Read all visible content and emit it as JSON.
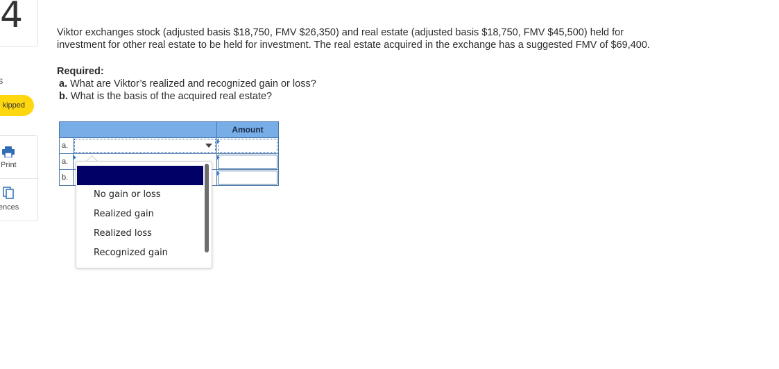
{
  "sidebar": {
    "question_number": "4",
    "points_label": "S",
    "status_badge": "kipped",
    "print_label": "Print",
    "references_label": "ferences"
  },
  "question": {
    "line1": "Viktor exchanges stock (adjusted basis $18,750, FMV $26,350) and real estate (adjusted basis $18,750, FMV $45,500) held for",
    "line2": "investment for other real estate to be held for investment. The real estate acquired in the exchange has a suggested FMV of $69,400.",
    "required_title": "Required:",
    "part_a_letter": "a.",
    "part_a_text": " What are Viktor’s realized and recognized gain or loss?",
    "part_b_letter": "b.",
    "part_b_text": " What is the basis of the acquired real estate?"
  },
  "table": {
    "amount_header": "Amount",
    "rows": [
      {
        "label": "a."
      },
      {
        "label": "a."
      },
      {
        "label": "b."
      }
    ]
  },
  "dropdown": {
    "options": [
      "No gain or loss",
      "Realized gain",
      "Realized loss",
      "Recognized gain"
    ]
  },
  "colors": {
    "header_blue": "#77aee8",
    "badge_yellow": "#ffd70f",
    "selected_navy": "#000066"
  }
}
